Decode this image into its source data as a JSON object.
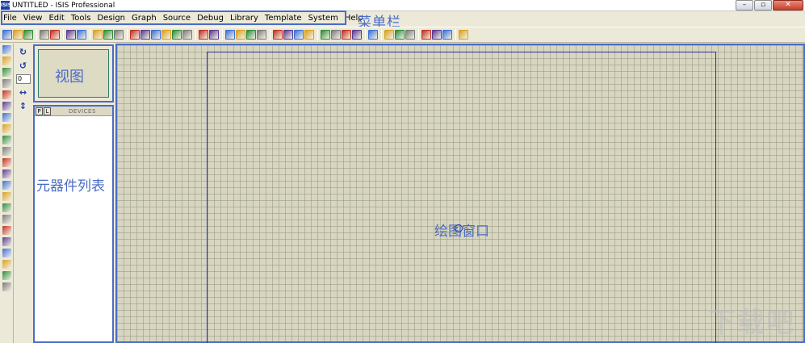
{
  "window": {
    "icon_text": "ISIS",
    "title": "UNTITLED - ISIS Professional",
    "controls": [
      "–",
      "▫",
      "✕"
    ]
  },
  "menu": [
    "File",
    "View",
    "Edit",
    "Tools",
    "Design",
    "Graph",
    "Source",
    "Debug",
    "Library",
    "Template",
    "System",
    "Help"
  ],
  "annotations": {
    "menu_bar": "菜单栏",
    "overview": "视图",
    "device_list": "元器件列表",
    "drawing_window": "绘图窗口"
  },
  "devices_panel": {
    "p_button": "P",
    "l_button": "L",
    "title": "DEVICES"
  },
  "rotation": {
    "angle_value": "0"
  },
  "toolbar_colors": [
    "#3a6fd8",
    "#d9a020",
    "#2e8b3a",
    "#7a7a7a",
    "#c03020",
    "#5a3a90"
  ],
  "watermark": "下载吧"
}
